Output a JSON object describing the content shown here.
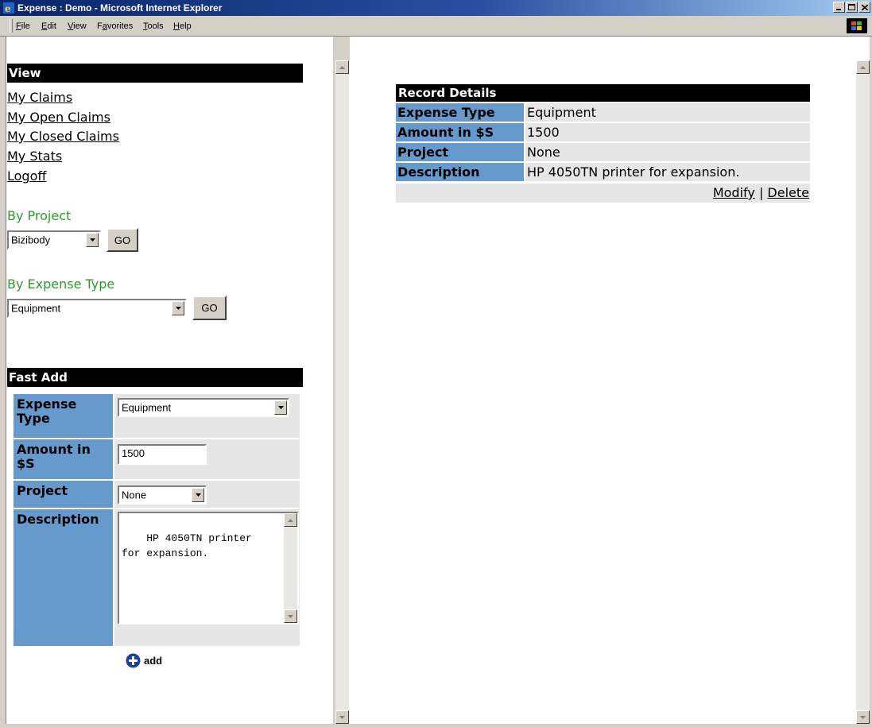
{
  "window": {
    "title": "Expense : Demo - Microsoft Internet Explorer"
  },
  "menu": {
    "items": [
      {
        "label": "File",
        "accel": "F",
        "rest": "ile"
      },
      {
        "label": "Edit",
        "accel": "E",
        "rest": "dit"
      },
      {
        "label": "View",
        "accel": "V",
        "rest": "iew"
      },
      {
        "label": "Favorites",
        "pre": "F",
        "accel": "a",
        "rest": "vorites"
      },
      {
        "label": "Tools",
        "accel": "T",
        "rest": "ools"
      },
      {
        "label": "Help",
        "accel": "H",
        "rest": "elp"
      }
    ]
  },
  "view_panel": {
    "header": "View",
    "links": [
      "My Claims",
      "My Open Claims",
      "My Closed Claims",
      "My Stats",
      "Logoff"
    ],
    "by_project": {
      "label": "By Project",
      "selected": "Bizibody",
      "button": "GO"
    },
    "by_expense_type": {
      "label": "By Expense Type",
      "selected": "Equipment",
      "button": "GO"
    }
  },
  "fast_add": {
    "header": "Fast Add",
    "expense_type_label_1": "Expense",
    "expense_type_label_2": "Type",
    "expense_type_value": "Equipment",
    "amount_label_1": "Amount in",
    "amount_label_2": "$S",
    "amount_value": "1500",
    "project_label": "Project",
    "project_value": "None",
    "description_label": "Description",
    "description_value": "HP 4050TN printer\nfor expansion.",
    "add_label": "add"
  },
  "record_details": {
    "header": "Record Details",
    "rows": [
      {
        "label": "Expense Type",
        "value": "Equipment"
      },
      {
        "label": "Amount in $S",
        "value": "1500"
      },
      {
        "label": "Project",
        "value": "None"
      },
      {
        "label": "Description",
        "value": "HP 4050TN printer for expansion."
      }
    ],
    "modify": "Modify",
    "separator": "|",
    "delete": "Delete"
  },
  "colors": {
    "label_blue": "#6699cc",
    "value_gray": "#e6e6e6",
    "section_green": "#2e9a2e",
    "title_blue": "#0a246a"
  }
}
